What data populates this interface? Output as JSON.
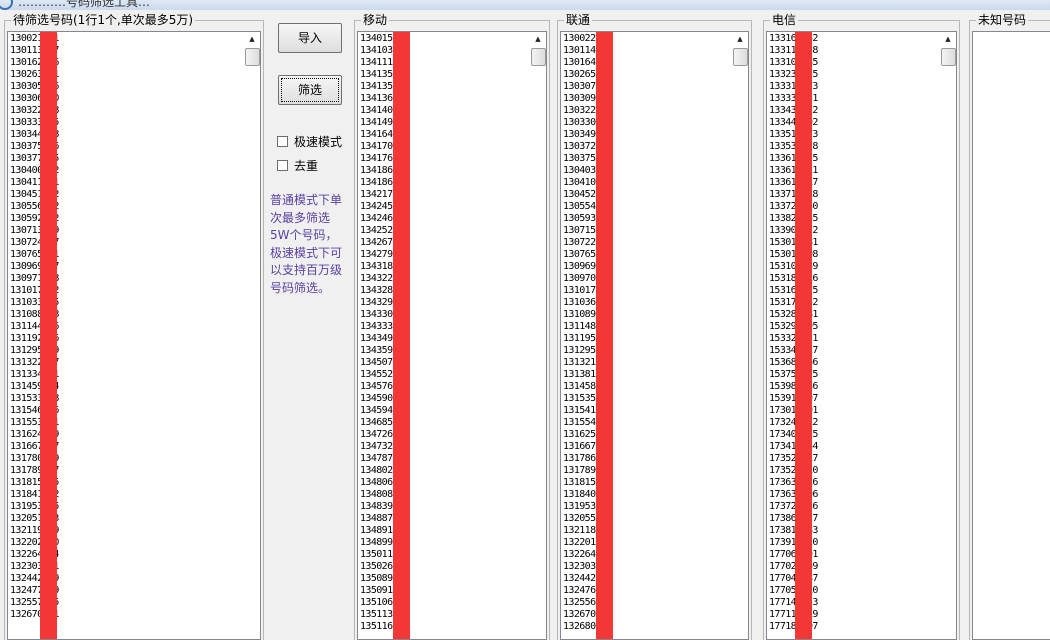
{
  "window": {
    "title": "…………号码筛选工具…"
  },
  "groups": {
    "pending": {
      "label": "待筛选号码(1行1个,单次最多5万)",
      "rows": [
        "130021221",
        "130113227",
        "130162156",
        "130263741",
        "130305766",
        "130306870",
        "130322948",
        "130333915",
        "130344308",
        "130375176",
        "130377105",
        "130400522",
        "130411111",
        "130451992",
        "130556062",
        "130592552",
        "130713209",
        "130724997",
        "130765621",
        "130969887",
        "130971928",
        "131017882",
        "131033735",
        "131088888",
        "131144266",
        "131192436",
        "131295379",
        "131322587",
        "131334051",
        "131459524",
        "131533398",
        "131546276",
        "131553021",
        "131624319",
        "131667887",
        "131780069",
        "131789427",
        "131815175",
        "131841742",
        "131953575",
        "132051753",
        "132119469",
        "132202460",
        "132264214",
        "132303771",
        "132442499",
        "132477089",
        "132557955",
        "132670701"
      ]
    },
    "mobile": {
      "label": "移动",
      "rows": [
        "134015242",
        "134103533",
        "134111807",
        "134135543",
        "134135994",
        "134136788",
        "134140557",
        "134149685",
        "134164001",
        "134170423",
        "134176648",
        "134186573",
        "134186592",
        "134217318",
        "134245512",
        "134246517",
        "134252386",
        "134267549",
        "134279121",
        "134318968",
        "134322720",
        "134328865",
        "134329183",
        "134330130",
        "134333183",
        "134349099",
        "134359049",
        "134507743",
        "134552889",
        "134576692",
        "134590650",
        "134594558",
        "134685570",
        "134726633",
        "134732046",
        "134787149",
        "134802063",
        "134806804",
        "134808581",
        "134839173",
        "134887032",
        "134891570",
        "134899303",
        "135011882",
        "135026152",
        "135089884",
        "135091211",
        "135106242",
        "135113877",
        "135116877"
      ]
    },
    "unicom": {
      "label": "联通",
      "rows": [
        "130022121",
        "130114027",
        "130164756",
        "130265841",
        "130307766",
        "130309470",
        "130322848",
        "130330115",
        "130349608",
        "130372976",
        "130375605",
        "130403522",
        "130410311",
        "130452592",
        "130554662",
        "130593052",
        "130715009",
        "130722397",
        "130765621",
        "130969887",
        "130970428",
        "131017682",
        "131036135",
        "131089888",
        "131148666",
        "131195536",
        "131295479",
        "131321887",
        "131381251",
        "131458724",
        "131535598",
        "131541776",
        "131554621",
        "131625119",
        "131667387",
        "131786969",
        "131789127",
        "131815875",
        "131840542",
        "131953175",
        "132055653",
        "132118369",
        "132201360",
        "132264014",
        "132303671",
        "132442199",
        "132476689",
        "132556055",
        "132670301",
        "132680877"
      ]
    },
    "telecom": {
      "label": "电信",
      "rows": [
        "133166332",
        "133117838",
        "133107585",
        "133233355",
        "133310073",
        "133331751",
        "133433022",
        "133445002",
        "133518573",
        "133533478",
        "133613055",
        "133619511",
        "133613217",
        "133717718",
        "133720540",
        "133823345",
        "133907822",
        "153018681",
        "153016198",
        "153101549",
        "153184816",
        "153168375",
        "153177752",
        "153283381",
        "153299395",
        "153322921",
        "153344327",
        "153682766",
        "153755075",
        "153981946",
        "153917197",
        "173012301",
        "173243712",
        "173408335",
        "173415244",
        "173522217",
        "173526210",
        "173634016",
        "173630196",
        "173726136",
        "173869227",
        "173813783",
        "173918420",
        "177063391",
        "177022469",
        "177047287",
        "177055410",
        "177146153",
        "177110819",
        "177180707"
      ]
    },
    "unknown": {
      "label": "未知号码"
    }
  },
  "buttons": {
    "import": "导入",
    "filter": "筛选"
  },
  "options": {
    "fast_mode": "极速模式",
    "dedupe": "去重"
  },
  "note": "普通模式下单次最多筛选5W个号码，极速模式下可以支持百万级号码筛选。",
  "colors": {
    "redaction": "#f33636",
    "note_text": "#5a3fa3"
  }
}
